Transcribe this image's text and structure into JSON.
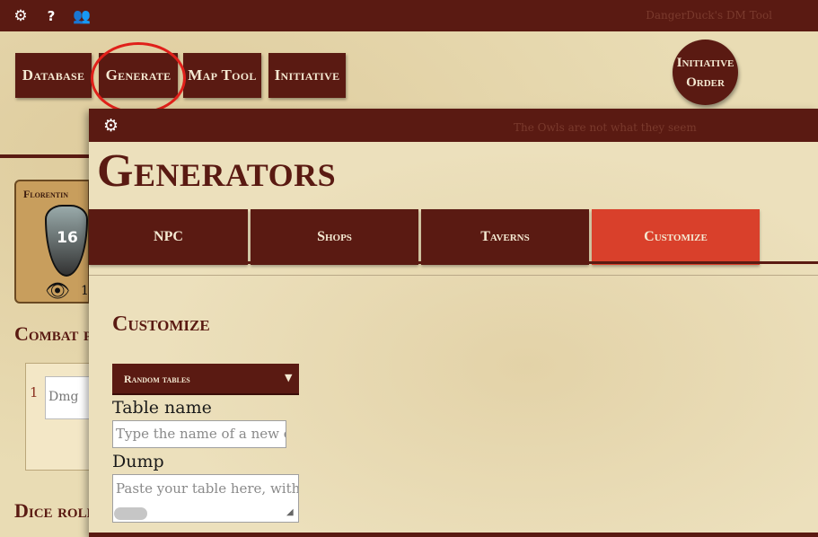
{
  "topbar": {
    "settings_icon": "⚙",
    "help_icon": "?",
    "users_icon": "👥",
    "app_title": "DangerDuck's DM Tool"
  },
  "nav": {
    "database": "Database",
    "generate": "Generate",
    "map_tool": "Map Tool",
    "initiative": "Initiative",
    "initiative_order_line1": "Initiative",
    "initiative_order_line2": "Order"
  },
  "background": {
    "character_name": "Florentin",
    "armor_class": "16",
    "perception": "1",
    "combat_heading": "Combat pa",
    "dmg_row_number": "1",
    "dmg_placeholder": "Dmg",
    "dice_heading": "Dice roll"
  },
  "modal": {
    "gear_icon": "⚙",
    "subtitle": "The Owls are not what they seem",
    "title": "Generators",
    "tabs": [
      {
        "label": "NPC"
      },
      {
        "label": "Shops"
      },
      {
        "label": "Taverns"
      },
      {
        "label": "Customize"
      }
    ],
    "active_tab": "Customize",
    "section_heading": "Customize",
    "select": {
      "value": "Random tables",
      "arrow": "▼"
    },
    "table_name": {
      "label": "Table name",
      "placeholder": "Type the name of a new or existing table"
    },
    "dump": {
      "label": "Dump",
      "placeholder": "Paste your table here, with one entry per line"
    }
  },
  "colors": {
    "primary": "#5a1a12",
    "accent_active": "#d9402b",
    "highlight_ring": "#e0201a",
    "parchment": "#e9dcb4"
  }
}
